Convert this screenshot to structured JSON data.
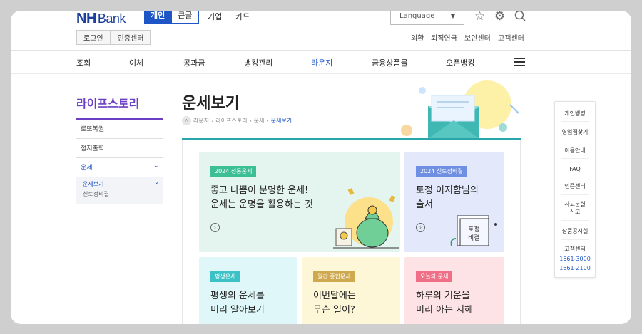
{
  "header": {
    "logo_nh": "NH",
    "logo_bank": "Bank",
    "segments": [
      {
        "label": "개인"
      },
      {
        "label": "큰글"
      }
    ],
    "top_nav": [
      "기업",
      "카드"
    ],
    "language": "Language",
    "login": "로그인",
    "cert": "인증센터",
    "util_links": [
      "외환",
      "퇴직연금",
      "보안센터",
      "고객센터"
    ]
  },
  "gnb": {
    "items": [
      "조회",
      "이체",
      "공과금",
      "뱅킹관리",
      "라운지",
      "금융상품몰",
      "오픈뱅킹"
    ],
    "active": "라운지"
  },
  "lnb": {
    "title": "라이프스토리",
    "items": [
      "로또복권",
      "점저출력",
      "운세"
    ],
    "sub_active": "운세보기",
    "sub_item": "신토정비결"
  },
  "page": {
    "title": "운세보기",
    "breadcrumb": [
      "라운지",
      "라이프스토리",
      "운세",
      "운세보기"
    ]
  },
  "cards": [
    {
      "tag": "2024 정통운세",
      "line1": "좋고 나쁨이 분명한 운세!",
      "line2": "운세는 운명을 활용하는 것",
      "bg": "#e4f5ef",
      "tag_bg": "#3dbf95"
    },
    {
      "tag": "2024 신토정비결",
      "line1": "토정 이지함님의",
      "line2": "술서",
      "bg": "#e3e9fb",
      "tag_bg": "#6f8fe3",
      "book": "토정\n비결"
    },
    {
      "tag": "평생운세",
      "line1": "평생의 운세를",
      "line2": "미리 알아보기",
      "bg": "#dff7f8",
      "tag_bg": "#3cc1c6"
    },
    {
      "tag": "월간 종합운세",
      "line1": "이번달에는",
      "line2": "무슨 일이?",
      "bg": "#fdf6d7",
      "tag_bg": "#cfa950"
    },
    {
      "tag": "오늘의 운세",
      "line1": "하루의 기운을",
      "line2": "미리 아는 지혜",
      "bg": "#fde3e6",
      "tag_bg": "#ef6f86"
    }
  ],
  "quick_menu": {
    "items": [
      "개인뱅킹",
      "영업점찾기",
      "이용안내",
      "FAQ",
      "인증센터",
      "사고분실\n신고",
      "상품공시실",
      "고객센터"
    ],
    "phones": [
      "1661-3000",
      "1661-2100"
    ]
  }
}
